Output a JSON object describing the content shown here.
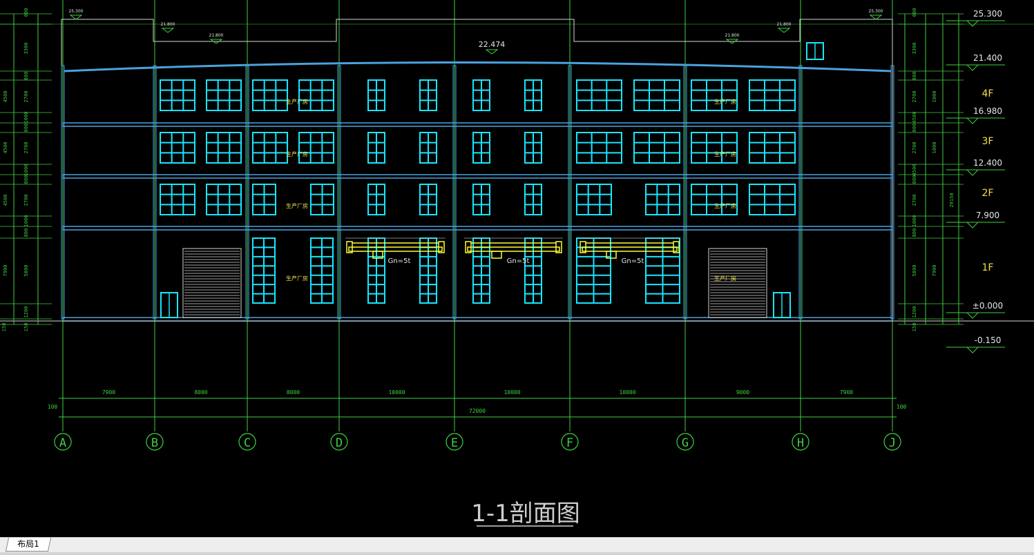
{
  "drawing": {
    "title": "1-1剖面图",
    "top_level_labels": [
      "25.300",
      "25.300",
      "21.800",
      "21.800",
      "21.800",
      "21.800",
      "22.474"
    ],
    "right_elevations": [
      "25.300",
      "21.400",
      "16.980",
      "12.400",
      "7.900",
      "±0.000",
      "-0.150"
    ],
    "floor_labels": [
      "4F",
      "3F",
      "2F",
      "1F"
    ],
    "axis_labels": [
      "A",
      "B",
      "C",
      "D",
      "E",
      "F",
      "G",
      "H",
      "J"
    ],
    "bay_dimensions": [
      "7900",
      "8000",
      "8000",
      "10000",
      "10000",
      "10000",
      "9000",
      "7900"
    ],
    "total_dimension": "72000",
    "edge_dimensions": [
      "100",
      "100"
    ],
    "left_dims": [
      "600",
      "3300",
      "800",
      "2700",
      "1000",
      "4500",
      "800",
      "2700",
      "1000",
      "4500",
      "800",
      "2700",
      "1000",
      "4500",
      "800",
      "5800",
      "1200",
      "7900",
      "150",
      "150"
    ],
    "right_dims": [
      "600",
      "3300",
      "800",
      "2700",
      "1000",
      "4500",
      "800",
      "2700",
      "1000",
      "4500",
      "800",
      "2700",
      "29150",
      "1000",
      "800",
      "5800",
      "7900",
      "1200",
      "150"
    ],
    "room_labels": [
      "生产厂房",
      "生产厂房",
      "生产厂房",
      "生产厂房",
      "生产厂房",
      "生产厂房",
      "生产厂房",
      "生产厂房"
    ],
    "crane_labels": [
      "Gn=5t",
      "Gn=5t",
      "Gn=5t"
    ]
  },
  "colors": {
    "grid": "#3fd23f",
    "structure": "#4aa3e0",
    "window": "#19e6ff",
    "crane": "#ffff33",
    "line": "#d8d8d8"
  },
  "tabs": {
    "layout1": "布局1"
  }
}
